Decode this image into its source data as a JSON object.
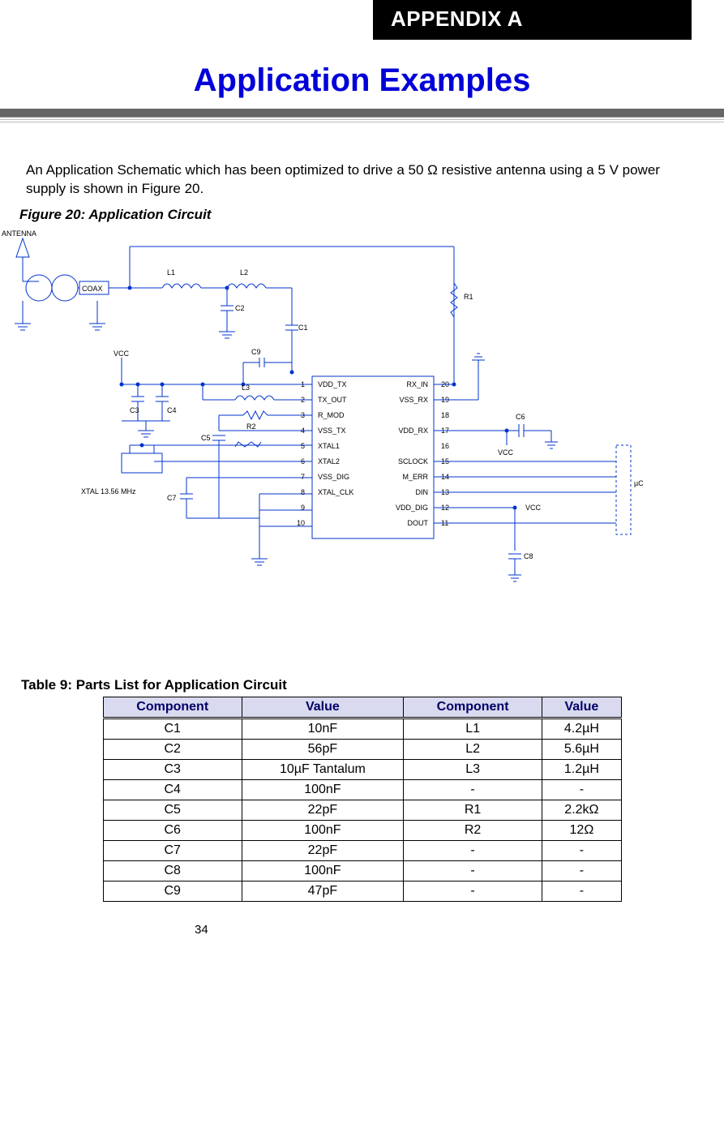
{
  "appendix_label": "APPENDIX A",
  "title": "Application Examples",
  "intro": "An Application Schematic which has been optimized to drive a 50 Ω resistive antenna using a 5 V power supply is shown in Figure 20.",
  "figure_caption": "Figure 20: Application Circuit",
  "schematic": {
    "antenna": "ANTENNA",
    "coax": "COAX",
    "vcc_left": "VCC",
    "vcc_right_top": "VCC",
    "vcc_right_bot": "VCC",
    "xtal": "XTAL 13.56 MHz",
    "uc": "µC",
    "refs": {
      "L1": "L1",
      "L2": "L2",
      "L3": "L3",
      "C1": "C1",
      "C2": "C2",
      "C3": "C3",
      "C4": "C4",
      "C5": "C5",
      "C6": "C6",
      "C7": "C7",
      "C8": "C8",
      "C9": "C9",
      "R1": "R1",
      "R2": "R2"
    },
    "left_pins": [
      {
        "n": "1",
        "name": "VDD_TX"
      },
      {
        "n": "2",
        "name": "TX_OUT"
      },
      {
        "n": "3",
        "name": "R_MOD"
      },
      {
        "n": "4",
        "name": "VSS_TX"
      },
      {
        "n": "5",
        "name": "XTAL1"
      },
      {
        "n": "6",
        "name": "XTAL2"
      },
      {
        "n": "7",
        "name": "VSS_DIG"
      },
      {
        "n": "8",
        "name": "XTAL_CLK"
      },
      {
        "n": "9",
        "name": ""
      },
      {
        "n": "10",
        "name": ""
      }
    ],
    "right_pins": [
      {
        "n": "20",
        "name": "RX_IN"
      },
      {
        "n": "19",
        "name": "VSS_RX"
      },
      {
        "n": "18",
        "name": ""
      },
      {
        "n": "17",
        "name": "VDD_RX"
      },
      {
        "n": "16",
        "name": ""
      },
      {
        "n": "15",
        "name": "SCLOCK"
      },
      {
        "n": "14",
        "name": "M_ERR"
      },
      {
        "n": "13",
        "name": "DIN"
      },
      {
        "n": "12",
        "name": "VDD_DIG"
      },
      {
        "n": "11",
        "name": "DOUT"
      }
    ]
  },
  "table_caption": "Table 9: Parts List for Application Circuit",
  "table_headers": [
    "Component",
    "Value",
    "Component",
    "Value"
  ],
  "parts_rows": [
    [
      "C1",
      "10nF",
      "L1",
      "4.2µH"
    ],
    [
      "C2",
      "56pF",
      "L2",
      "5.6µH"
    ],
    [
      "C3",
      "10µF Tantalum",
      "L3",
      "1.2µH"
    ],
    [
      "C4",
      "100nF",
      "-",
      "-"
    ],
    [
      "C5",
      "22pF",
      "R1",
      "2.2kΩ"
    ],
    [
      "C6",
      "100nF",
      "R2",
      "12Ω"
    ],
    [
      "C7",
      "22pF",
      "-",
      "-"
    ],
    [
      "C8",
      "100nF",
      "-",
      "-"
    ],
    [
      "C9",
      "47pF",
      "-",
      "-"
    ]
  ],
  "page_number": "34"
}
